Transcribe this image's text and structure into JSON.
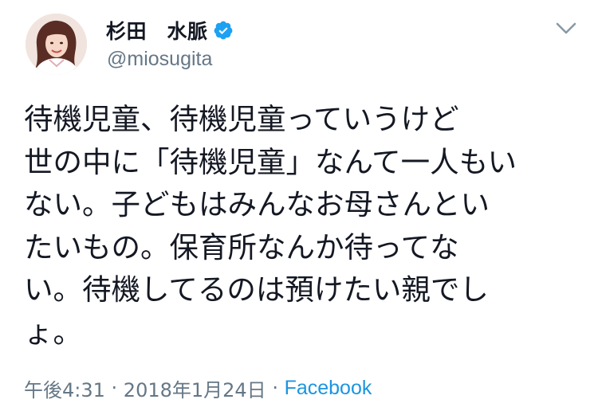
{
  "tweet": {
    "author": {
      "display_name": "杉田　水脈",
      "handle": "@miosugita",
      "verified": true,
      "avatar_icon": "avatar-photo",
      "verified_icon": "verified-badge-icon",
      "verified_color": "#1da1f2"
    },
    "menu_icon": "chevron-down-icon",
    "text_lines": [
      "待機児童、待機児童っていうけど",
      "世の中に「待機児童」なんて一人もい",
      "ない。子どもはみんなお母さんとい",
      "たいもの。保育所なんか待ってな",
      "い。待機してるのは預けたい親でし",
      "ょ。"
    ],
    "meta": {
      "time": "午後4:31",
      "separator": " · ",
      "date": "2018年1月24日",
      "source": "Facebook",
      "source_color": "#1b95e0"
    }
  }
}
